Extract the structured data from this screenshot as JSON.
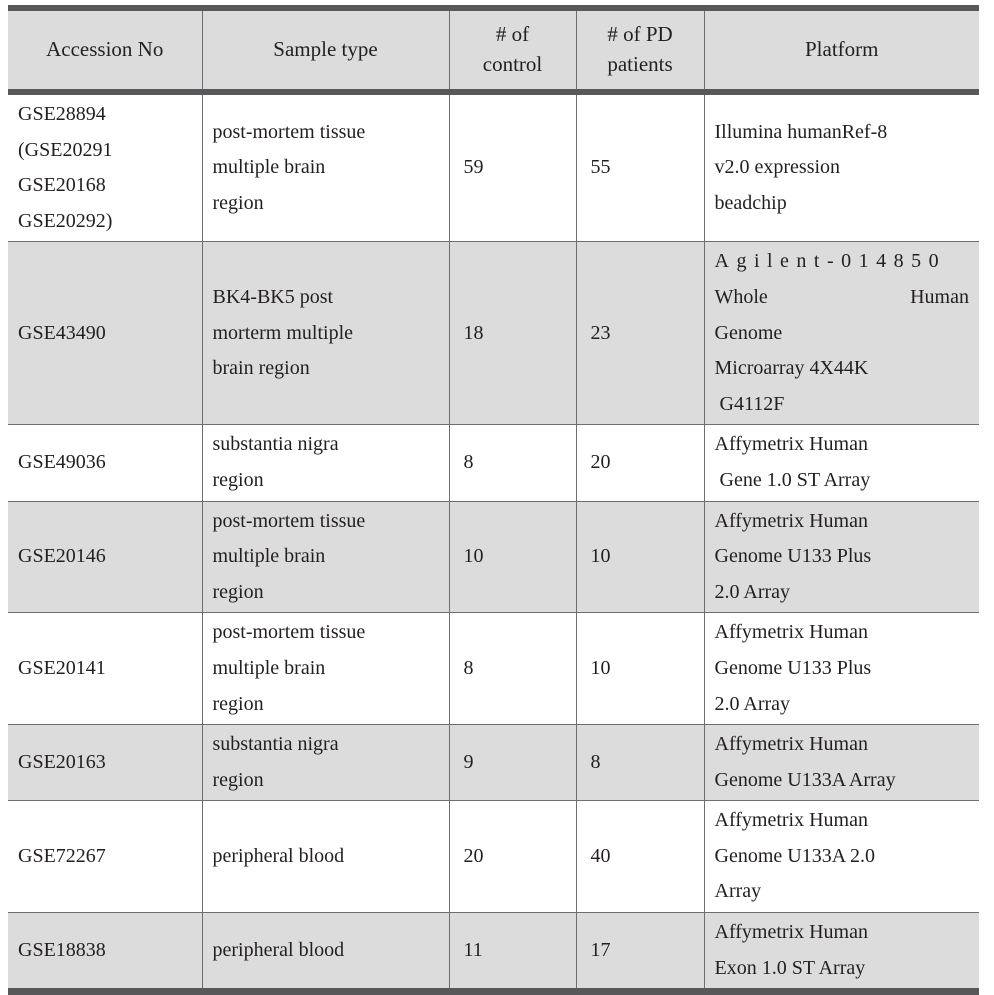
{
  "table": {
    "caption_visible": false,
    "colors": {
      "rule": "#58585a",
      "gridline": "#6d6e70",
      "shaded_row_bg": "#dcdcdc",
      "plain_row_bg": "#ffffff",
      "text": "#231f20"
    },
    "columns": [
      {
        "key": "accession",
        "label_line1": "Accession No",
        "label_line2": ""
      },
      {
        "key": "sample_type",
        "label_line1": "Sample type",
        "label_line2": ""
      },
      {
        "key": "n_control",
        "label_line1": "# of",
        "label_line2": "control"
      },
      {
        "key": "n_pd",
        "label_line1": "# of PD",
        "label_line2": "patients"
      },
      {
        "key": "platform",
        "label_line1": "Platform",
        "label_line2": ""
      }
    ],
    "rows": [
      {
        "shaded": false,
        "accession": [
          "GSE28894",
          "(GSE20291",
          "GSE20168",
          "GSE20292)"
        ],
        "sample_type": [
          "post-mortem tissue",
          "multiple brain",
          "region"
        ],
        "n_control": "59",
        "n_pd": "55",
        "platform": [
          "Illumina humanRef-8",
          "v2.0 expression",
          "beadchip"
        ]
      },
      {
        "shaded": true,
        "accession": [
          "GSE43490"
        ],
        "sample_type": [
          "BK4-BK5 post",
          "morterm multiple",
          "brain region"
        ],
        "n_control": "18",
        "n_pd": "23",
        "platform_special": {
          "tracked_line": "Agilent-014850",
          "justified_line": [
            "Whole",
            "Human"
          ],
          "lines": [
            "Genome",
            "Microarray 4X44K",
            " G4112F"
          ]
        }
      },
      {
        "shaded": false,
        "accession": [
          "GSE49036"
        ],
        "sample_type": [
          "substantia nigra",
          "region"
        ],
        "n_control": "8",
        "n_pd": "20",
        "platform": [
          "Affymetrix Human",
          " Gene 1.0 ST Array"
        ]
      },
      {
        "shaded": true,
        "accession": [
          "GSE20146"
        ],
        "sample_type": [
          "post-mortem tissue",
          "multiple brain",
          "region"
        ],
        "n_control": "10",
        "n_pd": "10",
        "platform": [
          "Affymetrix Human",
          "Genome U133 Plus",
          "2.0 Array"
        ]
      },
      {
        "shaded": false,
        "accession": [
          "GSE20141"
        ],
        "sample_type": [
          "post-mortem tissue",
          "multiple brain",
          "region"
        ],
        "n_control": "8",
        "n_pd": "10",
        "platform": [
          "Affymetrix Human",
          "Genome U133 Plus",
          "2.0 Array"
        ]
      },
      {
        "shaded": true,
        "accession": [
          "GSE20163"
        ],
        "sample_type": [
          "substantia nigra",
          "region"
        ],
        "n_control": "9",
        "n_pd": "8",
        "platform": [
          "Affymetrix Human",
          "Genome U133A Array"
        ]
      },
      {
        "shaded": false,
        "accession": [
          "GSE72267"
        ],
        "sample_type": [
          "peripheral blood"
        ],
        "n_control": "20",
        "n_pd": "40",
        "platform": [
          "Affymetrix Human",
          "Genome U133A 2.0",
          "Array"
        ]
      },
      {
        "shaded": true,
        "accession": [
          "GSE18838"
        ],
        "sample_type": [
          "peripheral blood"
        ],
        "n_control": "11",
        "n_pd": "17",
        "platform": [
          "Affymetrix Human",
          "Exon 1.0 ST Array"
        ]
      }
    ]
  }
}
